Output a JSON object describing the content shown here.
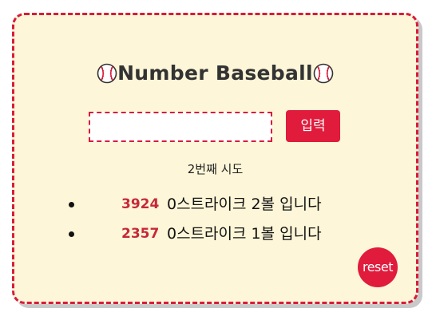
{
  "app": {
    "title": "Number Baseball"
  },
  "form": {
    "input_value": "",
    "submit_label": "입력"
  },
  "status": {
    "attempt_text": "2번째 시도"
  },
  "history": [
    {
      "guess": "3924",
      "result": "0스트라이크 2볼 입니다"
    },
    {
      "guess": "2357",
      "result": "0스트라이크 1볼 입니다"
    }
  ],
  "controls": {
    "reset_label": "reset"
  },
  "icons": {
    "title_left": "baseball-icon",
    "title_right": "baseball-icon"
  },
  "colors": {
    "accent": "#e01b3c",
    "card_background": "#fdf6d8",
    "guess_text": "#c62839"
  }
}
